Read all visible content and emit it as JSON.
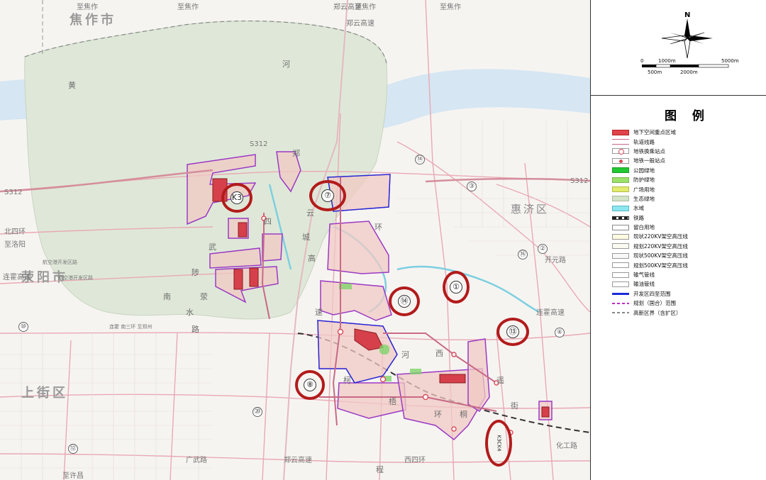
{
  "map": {
    "top_road_labels": [
      "至焦作",
      "至焦作",
      "郑云高速",
      "至焦作",
      "至焦作"
    ],
    "city_labels": [
      "焦作市",
      "荥阳市",
      "上街区"
    ],
    "district_label": "惠济区",
    "river_chars": [
      "黄",
      "河"
    ],
    "road_labels": {
      "s312_a": "S312",
      "s312_b": "S312",
      "s312_c": "S312",
      "north_ring_a": "北四环",
      "north_ring_b": "至洛阳",
      "lianhuo_label": "连霍高速",
      "airport_a": "航空港开发区路",
      "airport_b": "航空港开发区路",
      "south_road": "连霍 南三环 至郑州",
      "kaiyuan": "开元路",
      "lianhuo_east": "连霍高速",
      "huagong": "化工路",
      "guangwu": "广武路",
      "zhenglian": "郑云高速",
      "xisihuan": "西四环",
      "zhixuchang": "至许昌",
      "zhengyun_top": "郑云高速"
    },
    "vertical_labels": [
      "郑",
      "云",
      "城",
      "高",
      "速",
      "武",
      "陟",
      "荥",
      "水",
      "路",
      "南",
      "河",
      "梧",
      "环",
      "遥",
      "街",
      "柯",
      "四",
      "环",
      "西",
      "桐",
      "程"
    ],
    "markers": [
      "K3",
      "⑦",
      "⑭",
      "①",
      "⑬",
      "⑧",
      "K3CK4"
    ],
    "route_numbers": [
      "⑭",
      "③",
      "⑯",
      "②",
      "④",
      "⑩",
      "⑫",
      "⑳"
    ]
  },
  "legend": {
    "north": "N",
    "scale": [
      "0",
      "1000m",
      "5000m",
      "500m",
      "2000m"
    ],
    "title": "图 例",
    "items": [
      {
        "label": "地下空间重点区域",
        "kind": "fill",
        "color": "#e0434c",
        "border": "#b22"
      },
      {
        "label": "轨道线路",
        "kind": "double-line",
        "color": "#c86a86"
      },
      {
        "label": "地铁换乘站点",
        "kind": "ring",
        "color": "#d84a5a"
      },
      {
        "label": "地铁一般站点",
        "kind": "dot-line",
        "color": "#d84a5a"
      },
      {
        "label": "公园绿地",
        "kind": "fill",
        "color": "#22c832",
        "border": "#1a9a26"
      },
      {
        "label": "防护绿地",
        "kind": "fill",
        "color": "#9be26a",
        "border": "#7bb44f"
      },
      {
        "label": "广场用地",
        "kind": "fill",
        "color": "#e2ec6e",
        "border": "#b2bb47"
      },
      {
        "label": "生态绿地",
        "kind": "fill",
        "color": "#d3e3c7",
        "border": "#a8b89f"
      },
      {
        "label": "水域",
        "kind": "fill",
        "color": "#8ce6f0",
        "border": "#5abac5"
      },
      {
        "label": "铁路",
        "kind": "rail",
        "color": "#222222"
      },
      {
        "label": "留白用地",
        "kind": "fill",
        "color": "#ffffff",
        "border": "#888"
      },
      {
        "label": "现状220KV架空高压线",
        "kind": "fill",
        "color": "#fffbe0",
        "border": "#999"
      },
      {
        "label": "规划220KV架空高压线",
        "kind": "fill",
        "color": "#fbfbf2",
        "border": "#999"
      },
      {
        "label": "现状500KV架空高压线",
        "kind": "fill",
        "color": "#f8f8f8",
        "border": "#999"
      },
      {
        "label": "规划500KV架空高压线",
        "kind": "fill",
        "color": "#ffffff",
        "border": "#999"
      },
      {
        "label": "输气管线",
        "kind": "fill",
        "color": "#ffffff",
        "border": "#999"
      },
      {
        "label": "输油管线",
        "kind": "fill",
        "color": "#ffffff",
        "border": "#999"
      },
      {
        "label": "开发区四至范围",
        "kind": "line",
        "color": "#1a2ad8"
      },
      {
        "label": "规划（国合）范围",
        "kind": "dash",
        "color": "#c02ac0"
      },
      {
        "label": "高新区界（含扩区）",
        "kind": "dash-grey",
        "color": "#888888"
      }
    ]
  },
  "colors": {
    "marker_red": "#b21b1b",
    "ecology_green": "#dfe8d8",
    "river_blue": "#d6e6f3",
    "road_pink": "#e8a9b4",
    "plan_purple": "#9b3ac4"
  }
}
